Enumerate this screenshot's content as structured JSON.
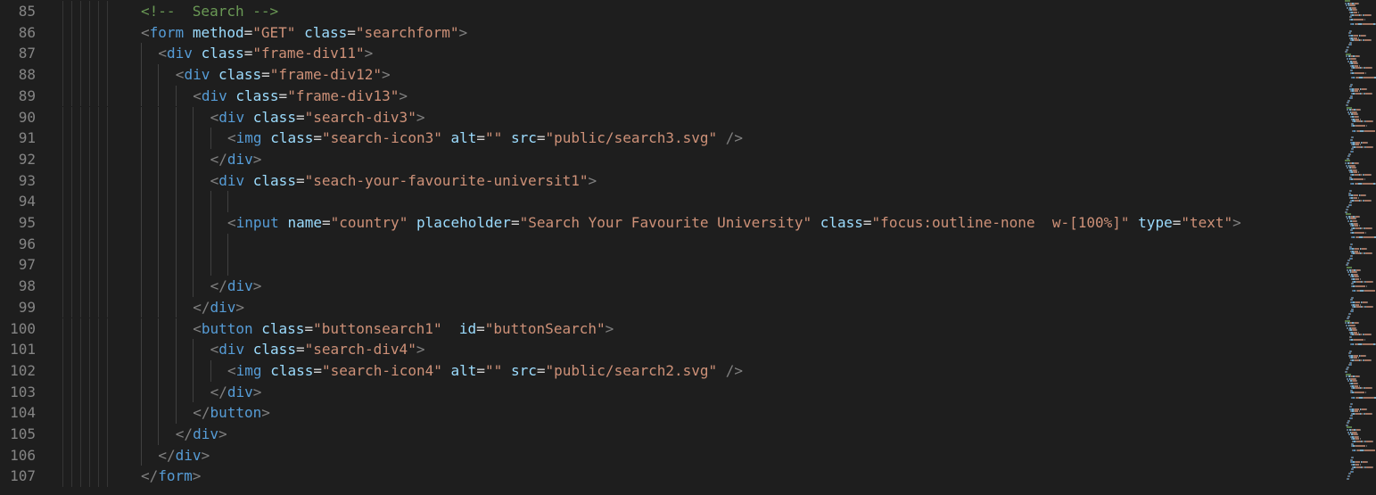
{
  "editor": {
    "lines": [
      {
        "num": "85",
        "indent": 0,
        "tokens": [
          {
            "c": "t-comment",
            "t": "<!--  Search -->"
          }
        ]
      },
      {
        "num": "86",
        "indent": 0,
        "tokens": [
          {
            "c": "t-punct",
            "t": "<"
          },
          {
            "c": "t-tag",
            "t": "form"
          },
          {
            "c": "t-eq",
            "t": " "
          },
          {
            "c": "t-attr",
            "t": "method"
          },
          {
            "c": "t-eq",
            "t": "="
          },
          {
            "c": "t-str",
            "t": "\"GET\""
          },
          {
            "c": "t-eq",
            "t": " "
          },
          {
            "c": "t-attr",
            "t": "class"
          },
          {
            "c": "t-eq",
            "t": "="
          },
          {
            "c": "t-str",
            "t": "\"searchform\""
          },
          {
            "c": "t-punct",
            "t": ">"
          }
        ]
      },
      {
        "num": "87",
        "indent": 1,
        "tokens": [
          {
            "c": "t-punct",
            "t": "<"
          },
          {
            "c": "t-tag",
            "t": "div"
          },
          {
            "c": "t-eq",
            "t": " "
          },
          {
            "c": "t-attr",
            "t": "class"
          },
          {
            "c": "t-eq",
            "t": "="
          },
          {
            "c": "t-str",
            "t": "\"frame-div11\""
          },
          {
            "c": "t-punct",
            "t": ">"
          }
        ]
      },
      {
        "num": "88",
        "indent": 2,
        "tokens": [
          {
            "c": "t-punct",
            "t": "<"
          },
          {
            "c": "t-tag",
            "t": "div"
          },
          {
            "c": "t-eq",
            "t": " "
          },
          {
            "c": "t-attr",
            "t": "class"
          },
          {
            "c": "t-eq",
            "t": "="
          },
          {
            "c": "t-str",
            "t": "\"frame-div12\""
          },
          {
            "c": "t-punct",
            "t": ">"
          }
        ]
      },
      {
        "num": "89",
        "indent": 3,
        "tokens": [
          {
            "c": "t-punct",
            "t": "<"
          },
          {
            "c": "t-tag",
            "t": "div"
          },
          {
            "c": "t-eq",
            "t": " "
          },
          {
            "c": "t-attr",
            "t": "class"
          },
          {
            "c": "t-eq",
            "t": "="
          },
          {
            "c": "t-str",
            "t": "\"frame-div13\""
          },
          {
            "c": "t-punct",
            "t": ">"
          }
        ]
      },
      {
        "num": "90",
        "indent": 4,
        "tokens": [
          {
            "c": "t-punct",
            "t": "<"
          },
          {
            "c": "t-tag",
            "t": "div"
          },
          {
            "c": "t-eq",
            "t": " "
          },
          {
            "c": "t-attr",
            "t": "class"
          },
          {
            "c": "t-eq",
            "t": "="
          },
          {
            "c": "t-str",
            "t": "\"search-div3\""
          },
          {
            "c": "t-punct",
            "t": ">"
          }
        ]
      },
      {
        "num": "91",
        "indent": 5,
        "tokens": [
          {
            "c": "t-punct",
            "t": "<"
          },
          {
            "c": "t-tag",
            "t": "img"
          },
          {
            "c": "t-eq",
            "t": " "
          },
          {
            "c": "t-attr",
            "t": "class"
          },
          {
            "c": "t-eq",
            "t": "="
          },
          {
            "c": "t-str",
            "t": "\"search-icon3\""
          },
          {
            "c": "t-eq",
            "t": " "
          },
          {
            "c": "t-attr",
            "t": "alt"
          },
          {
            "c": "t-eq",
            "t": "="
          },
          {
            "c": "t-str",
            "t": "\"\""
          },
          {
            "c": "t-eq",
            "t": " "
          },
          {
            "c": "t-attr",
            "t": "src"
          },
          {
            "c": "t-eq",
            "t": "="
          },
          {
            "c": "t-str",
            "t": "\"public/search3.svg\""
          },
          {
            "c": "t-eq",
            "t": " "
          },
          {
            "c": "t-punct",
            "t": "/>"
          }
        ]
      },
      {
        "num": "92",
        "indent": 4,
        "tokens": [
          {
            "c": "t-punct",
            "t": "</"
          },
          {
            "c": "t-tag",
            "t": "div"
          },
          {
            "c": "t-punct",
            "t": ">"
          }
        ]
      },
      {
        "num": "93",
        "indent": 4,
        "tokens": [
          {
            "c": "t-punct",
            "t": "<"
          },
          {
            "c": "t-tag",
            "t": "div"
          },
          {
            "c": "t-eq",
            "t": " "
          },
          {
            "c": "t-attr",
            "t": "class"
          },
          {
            "c": "t-eq",
            "t": "="
          },
          {
            "c": "t-str",
            "t": "\"seach-your-favourite-universit1\""
          },
          {
            "c": "t-punct",
            "t": ">"
          }
        ]
      },
      {
        "num": "94",
        "indent": 5,
        "tokens": []
      },
      {
        "num": "95",
        "indent": 5,
        "tokens": [
          {
            "c": "t-punct",
            "t": "<"
          },
          {
            "c": "t-tag",
            "t": "input"
          },
          {
            "c": "t-eq",
            "t": " "
          },
          {
            "c": "t-attr",
            "t": "name"
          },
          {
            "c": "t-eq",
            "t": "="
          },
          {
            "c": "t-str",
            "t": "\"country\""
          },
          {
            "c": "t-eq",
            "t": " "
          },
          {
            "c": "t-attr",
            "t": "placeholder"
          },
          {
            "c": "t-eq",
            "t": "="
          },
          {
            "c": "t-str",
            "t": "\"Search Your Favourite University\""
          },
          {
            "c": "t-eq",
            "t": " "
          },
          {
            "c": "t-attr",
            "t": "class"
          },
          {
            "c": "t-eq",
            "t": "="
          },
          {
            "c": "t-str",
            "t": "\"focus:outline-none  w-[100%]\""
          },
          {
            "c": "t-eq",
            "t": " "
          },
          {
            "c": "t-attr",
            "t": "type"
          },
          {
            "c": "t-eq",
            "t": "="
          },
          {
            "c": "t-str",
            "t": "\"text\""
          },
          {
            "c": "t-punct",
            "t": ">"
          }
        ]
      },
      {
        "num": "96",
        "indent": 5,
        "tokens": []
      },
      {
        "num": "97",
        "indent": 5,
        "tokens": []
      },
      {
        "num": "98",
        "indent": 4,
        "tokens": [
          {
            "c": "t-punct",
            "t": "</"
          },
          {
            "c": "t-tag",
            "t": "div"
          },
          {
            "c": "t-punct",
            "t": ">"
          }
        ]
      },
      {
        "num": "99",
        "indent": 3,
        "tokens": [
          {
            "c": "t-punct",
            "t": "</"
          },
          {
            "c": "t-tag",
            "t": "div"
          },
          {
            "c": "t-punct",
            "t": ">"
          }
        ]
      },
      {
        "num": "100",
        "indent": 3,
        "tokens": [
          {
            "c": "t-punct",
            "t": "<"
          },
          {
            "c": "t-tag",
            "t": "button"
          },
          {
            "c": "t-eq",
            "t": " "
          },
          {
            "c": "t-attr",
            "t": "class"
          },
          {
            "c": "t-eq",
            "t": "="
          },
          {
            "c": "t-str",
            "t": "\"buttonsearch1\""
          },
          {
            "c": "t-eq",
            "t": "  "
          },
          {
            "c": "t-attr",
            "t": "id"
          },
          {
            "c": "t-eq",
            "t": "="
          },
          {
            "c": "t-str",
            "t": "\"buttonSearch\""
          },
          {
            "c": "t-punct",
            "t": ">"
          }
        ]
      },
      {
        "num": "101",
        "indent": 4,
        "tokens": [
          {
            "c": "t-punct",
            "t": "<"
          },
          {
            "c": "t-tag",
            "t": "div"
          },
          {
            "c": "t-eq",
            "t": " "
          },
          {
            "c": "t-attr",
            "t": "class"
          },
          {
            "c": "t-eq",
            "t": "="
          },
          {
            "c": "t-str",
            "t": "\"search-div4\""
          },
          {
            "c": "t-punct",
            "t": ">"
          }
        ]
      },
      {
        "num": "102",
        "indent": 5,
        "tokens": [
          {
            "c": "t-punct",
            "t": "<"
          },
          {
            "c": "t-tag",
            "t": "img"
          },
          {
            "c": "t-eq",
            "t": " "
          },
          {
            "c": "t-attr",
            "t": "class"
          },
          {
            "c": "t-eq",
            "t": "="
          },
          {
            "c": "t-str",
            "t": "\"search-icon4\""
          },
          {
            "c": "t-eq",
            "t": " "
          },
          {
            "c": "t-attr",
            "t": "alt"
          },
          {
            "c": "t-eq",
            "t": "="
          },
          {
            "c": "t-str",
            "t": "\"\""
          },
          {
            "c": "t-eq",
            "t": " "
          },
          {
            "c": "t-attr",
            "t": "src"
          },
          {
            "c": "t-eq",
            "t": "="
          },
          {
            "c": "t-str",
            "t": "\"public/search2.svg\""
          },
          {
            "c": "t-eq",
            "t": " "
          },
          {
            "c": "t-punct",
            "t": "/>"
          }
        ]
      },
      {
        "num": "103",
        "indent": 4,
        "tokens": [
          {
            "c": "t-punct",
            "t": "</"
          },
          {
            "c": "t-tag",
            "t": "div"
          },
          {
            "c": "t-punct",
            "t": ">"
          }
        ]
      },
      {
        "num": "104",
        "indent": 3,
        "tokens": [
          {
            "c": "t-punct",
            "t": "</"
          },
          {
            "c": "t-tag",
            "t": "button"
          },
          {
            "c": "t-punct",
            "t": ">"
          }
        ]
      },
      {
        "num": "105",
        "indent": 2,
        "tokens": [
          {
            "c": "t-punct",
            "t": "</"
          },
          {
            "c": "t-tag",
            "t": "div"
          },
          {
            "c": "t-punct",
            "t": ">"
          }
        ]
      },
      {
        "num": "106",
        "indent": 1,
        "tokens": [
          {
            "c": "t-punct",
            "t": "</"
          },
          {
            "c": "t-tag",
            "t": "div"
          },
          {
            "c": "t-punct",
            "t": ">"
          }
        ]
      },
      {
        "num": "107",
        "indent": 0,
        "tokens": [
          {
            "c": "t-punct",
            "t": "</"
          },
          {
            "c": "t-tag",
            "t": "form"
          },
          {
            "c": "t-punct",
            "t": ">"
          }
        ]
      }
    ]
  },
  "colors": {
    "background": "#1e1e1e",
    "line_number": "#858585",
    "tag": "#569cd6",
    "attribute": "#9cdcfe",
    "string": "#ce9178",
    "comment": "#6a9955",
    "punctuation": "#808080"
  }
}
